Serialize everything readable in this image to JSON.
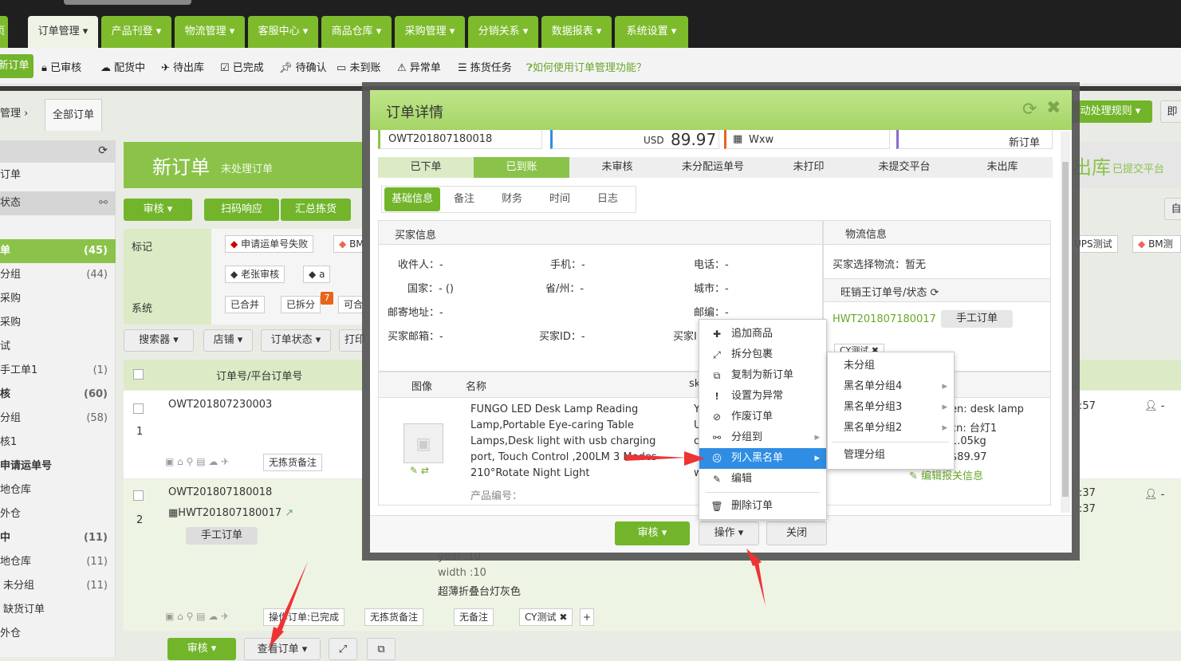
{
  "nav": {
    "home_partial": "页",
    "tabs": [
      "订单管理 ▾",
      "产品刊登 ▾",
      "物流管理 ▾",
      "客服中心 ▾",
      "商品仓库 ▾",
      "采购管理 ▾",
      "分销关系 ▾",
      "数据报表 ▾",
      "系统设置 ▾"
    ]
  },
  "subnav": {
    "new_order": "新订单",
    "items": [
      "已审核",
      "配货中",
      "待出库",
      "已完成",
      "待确认",
      "未到账",
      "异常单",
      "拣货任务"
    ],
    "help": "如何使用订单管理功能？"
  },
  "breadcrumb": {
    "parent": "管理",
    "current": "全部订单"
  },
  "right_toolbar": {
    "rules": "动处理规则",
    "extra": "即"
  },
  "sidebar": {
    "items": [
      {
        "label": "订单",
        "count": ""
      },
      {
        "label": "状态",
        "count": ""
      },
      {
        "label": "单",
        "count": "(45)"
      },
      {
        "label": "分组",
        "count": "(44)"
      },
      {
        "label": "采购",
        "count": ""
      },
      {
        "label": "采购",
        "count": ""
      },
      {
        "label": "试",
        "count": ""
      },
      {
        "label": "手工单1",
        "count": "(1)"
      },
      {
        "label": "核",
        "count": "(60)"
      },
      {
        "label": "分组",
        "count": "(58)"
      },
      {
        "label": "核1",
        "count": ""
      },
      {
        "label": "申请运单号",
        "count": ""
      },
      {
        "label": "地仓库",
        "count": ""
      },
      {
        "label": "外仓",
        "count": ""
      },
      {
        "label": "中",
        "count": "(11)"
      },
      {
        "label": "地仓库",
        "count": "(11)"
      },
      {
        "label": "未分组",
        "count": "(11)"
      },
      {
        "label": "缺货订单",
        "count": ""
      },
      {
        "label": "外仓",
        "count": ""
      }
    ]
  },
  "main": {
    "title": "新订单",
    "subtitle": "未处理订单",
    "right_title": "出库",
    "right_subtitle": "已提交平台",
    "toolbar": {
      "audit": "审核",
      "scan": "扫码响应",
      "summary": "汇总拣货"
    },
    "mark_label": "标记",
    "system_label": "系统",
    "tags": [
      "申请运单号失败",
      "BM",
      "老张审核",
      "a",
      "UPS测试",
      "BM测"
    ],
    "system_tags": [
      "已合并",
      "已拆分",
      "可合"
    ],
    "split_badge": "7",
    "filters": [
      "搜索器 ▾",
      "店铺 ▾",
      "订单状态 ▾",
      "打印"
    ],
    "col_header": "订单号/平台订单号",
    "rows": [
      {
        "index": "1",
        "order": "OWT201807230003",
        "tag": "无拣货备注",
        "right": ":57"
      },
      {
        "index": "2",
        "order": "OWT201807180018",
        "platform": "HWT201807180017",
        "manual": "手工订单",
        "right1": ":37",
        "right2": ":37"
      }
    ],
    "row2_details": [
      "year :10",
      "width :10",
      "超薄折叠台灯灰色"
    ],
    "row2_tags": [
      "操作订单:已完成",
      "无拣货备注",
      "无备注",
      "CY测试"
    ],
    "bottom_buttons": {
      "audit": "审核",
      "view": "查看订单"
    }
  },
  "modal": {
    "title": "订单详情",
    "summary": {
      "order_no": "OWT201807180018",
      "amount_currency": "USD",
      "amount": "89.97",
      "shop": "Wxw",
      "status": "新订单"
    },
    "steps": [
      "已下单",
      "已到账",
      "未审核",
      "未分配运单号",
      "未打印",
      "未提交平台",
      "未出库"
    ],
    "tabs": [
      "基础信息",
      "备注",
      "财务",
      "时间",
      "日志"
    ],
    "buyer": {
      "header": "买家信息",
      "receiver": "收件人：-",
      "mobile": "手机：-",
      "phone": "电话：-",
      "country": "国家：- ()",
      "province": "省/州：-",
      "city": "城市：-",
      "address": "邮寄地址：-",
      "zip": "邮编：-",
      "email": "买家邮箱：-",
      "buyer_id": "买家ID：-",
      "buyer_other": "买家I"
    },
    "logistics": {
      "header": "物流信息",
      "choice": "买家选择物流：暂无",
      "wang_label": "旺销王订单号/状态",
      "wang_no": "HWT201807180017",
      "manual": "手工订单",
      "cy_tag": "CY测试"
    },
    "products": {
      "cols": [
        "图像",
        "名称",
        "sk"
      ],
      "name": "FUNGO LED Desk Lamp Reading Lamp,Portable Eye-caring Table Lamps,Desk light with usb charging port, Touch Control ,200LM 3 Modes 210°Rotate Night Light",
      "code_label": "产品编号：",
      "sku_partial": [
        "Y",
        "U",
        "c",
        "w"
      ],
      "right_info": [
        "en: desk lamp",
        "cn: 台灯1",
        "1.05kg",
        "$89.97"
      ],
      "edit_customs": "编辑报关信息"
    },
    "footer": {
      "audit": "审核",
      "ops": "操作 ▾",
      "close": "关闭"
    }
  },
  "ops_menu": {
    "items": [
      "追加商品",
      "拆分包裹",
      "复制为新订单",
      "设置为异常",
      "作废订单",
      "分组到",
      "列入黑名单",
      "编辑",
      "删除订单"
    ]
  },
  "blacklist_menu": {
    "items": [
      "未分组",
      "黑名单分组4",
      "黑名单分组3",
      "黑名单分组2",
      "管理分组"
    ]
  }
}
